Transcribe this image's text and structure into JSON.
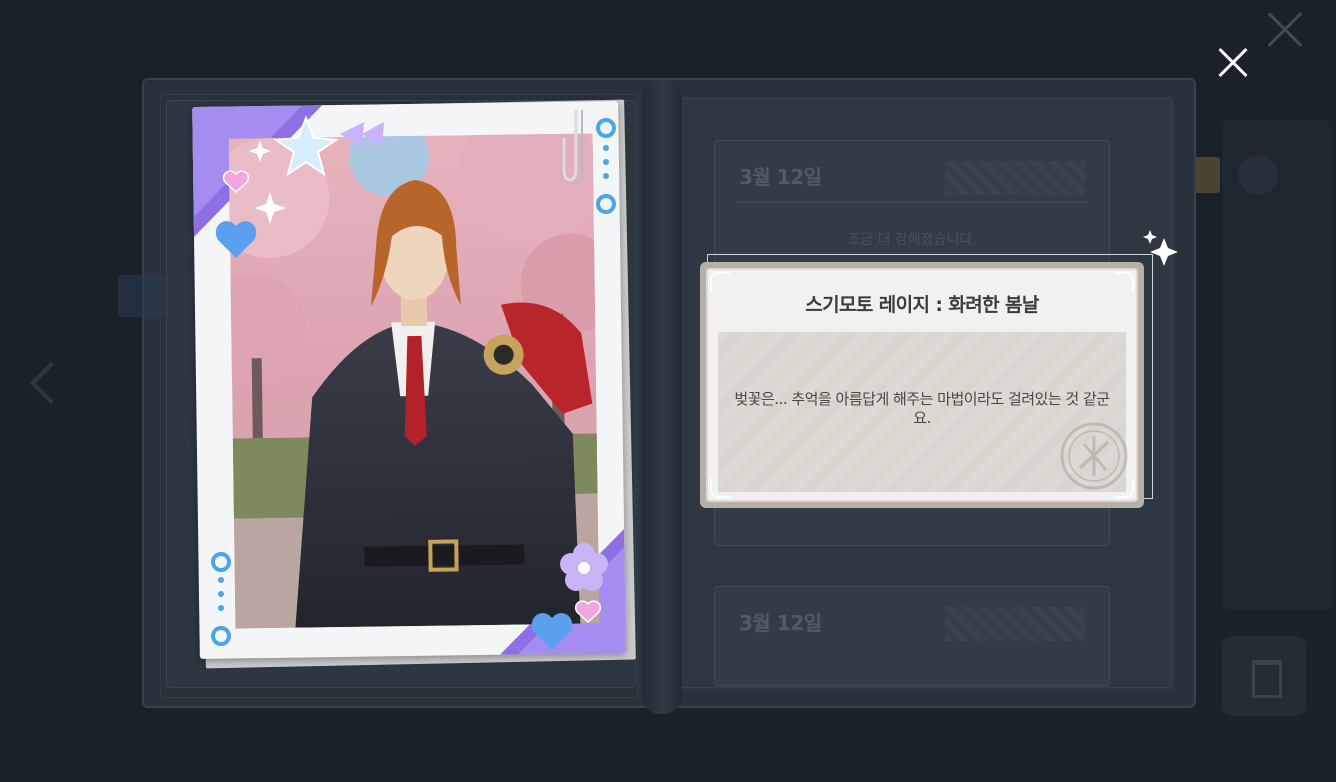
{
  "background": {
    "entries": [
      {
        "date": "3월 12일",
        "text_lines": [
          "조금 더 강해졌습니다.",
          ""
        ]
      },
      {
        "date": "3월 12일",
        "text_lines": []
      }
    ]
  },
  "card": {
    "subject": "character portrait under cherry blossoms"
  },
  "popup": {
    "title": "스기모토 레이지 : 화려한 봄날",
    "description": "벚꽃은... 추억을 아름답게 해주는 마법이라도 걸려있는 것 같군요."
  },
  "icons": {
    "close": "close-icon",
    "sparkle": "sparkle-icon",
    "seal": "seal-stamp-icon",
    "paperclip": "paperclip-icon"
  },
  "colors": {
    "card_ribbon": "#8e6fe6",
    "card_dots": "#49a5ee",
    "popup_bg": "#f2f1ef",
    "popup_border": "#b6b1a7"
  }
}
